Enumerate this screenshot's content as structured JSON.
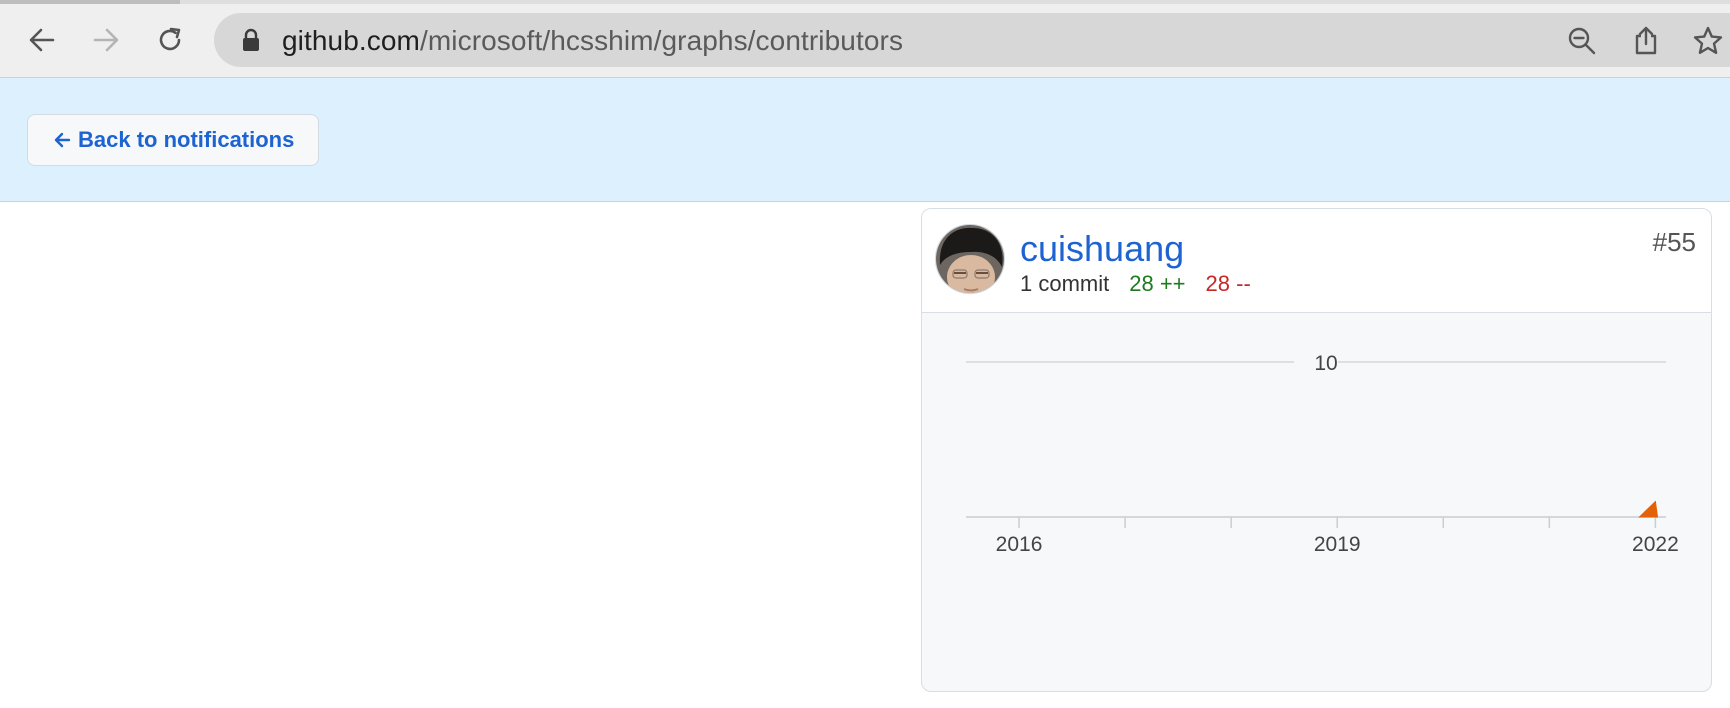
{
  "browser": {
    "url_host": "github.com",
    "url_path": "/microsoft/hcsshim/graphs/contributors"
  },
  "banner": {
    "back_label": "Back to notifications",
    "back_icon": "arrow-left-icon"
  },
  "contributor": {
    "username": "cuishuang",
    "commits": "1 commit",
    "additions": "28 ++",
    "deletions": "28 --",
    "rank": "#55"
  },
  "colors": {
    "link": "#1d63d1",
    "additions": "#1f7a1f",
    "deletions": "#c62828",
    "area_fill": "#e36209"
  },
  "chart_data": {
    "type": "area",
    "x_ticks": [
      "2016",
      "2019",
      "2022"
    ],
    "y_ticks": [
      10
    ],
    "ylim": [
      0,
      10
    ],
    "xlim": [
      2015.5,
      2022.1
    ],
    "series": [
      {
        "x": [
          2021.85,
          2022.0,
          2022.02
        ],
        "y": [
          0,
          1,
          0
        ]
      }
    ]
  }
}
